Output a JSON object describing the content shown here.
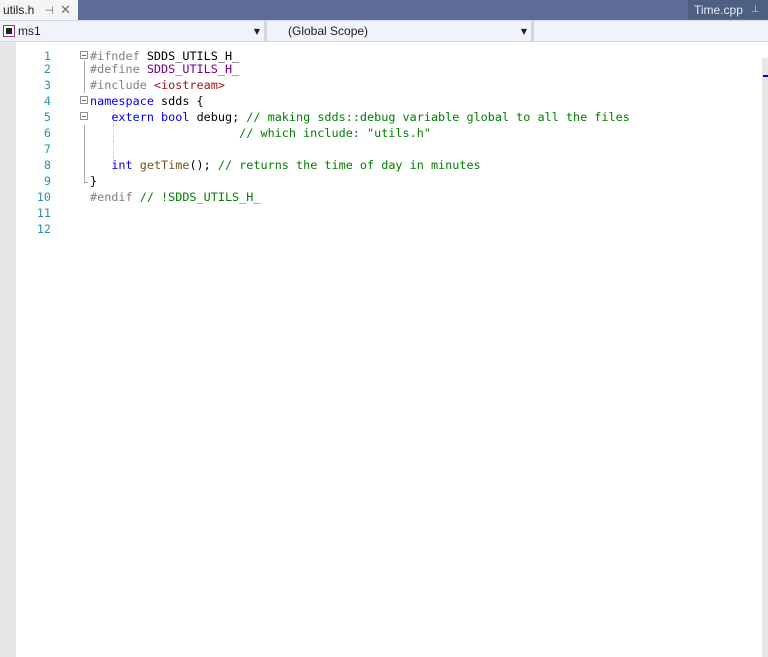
{
  "tabs": {
    "active": {
      "label": "utils.h",
      "pin_icon": "pin-icon",
      "close_icon": "close-icon"
    },
    "inactive": {
      "label": "Time.cpp",
      "pin_icon": "pin-icon"
    }
  },
  "navbar": {
    "project": "ms1",
    "scope": "(Global Scope)",
    "member": ""
  },
  "editor": {
    "lines": [
      {
        "n": "1",
        "tokens": [
          [
            "pp",
            "#ifndef "
          ],
          [
            "id",
            "SDDS_UTILS_H_"
          ]
        ]
      },
      {
        "n": "2",
        "tokens": [
          [
            "pp",
            "#define "
          ],
          [
            "macro",
            "SDDS_UTILS_H_"
          ]
        ]
      },
      {
        "n": "3",
        "tokens": [
          [
            "pp",
            "#include "
          ],
          [
            "str",
            "<iostream>"
          ]
        ]
      },
      {
        "n": "4",
        "tokens": [
          [
            "kw",
            "namespace"
          ],
          [
            "id",
            " sdds {"
          ]
        ]
      },
      {
        "n": "5",
        "tokens": [
          [
            "id",
            "   "
          ],
          [
            "kw",
            "extern"
          ],
          [
            "id",
            " "
          ],
          [
            "kw",
            "bool"
          ],
          [
            "id",
            " debug; "
          ],
          [
            "cm",
            "// making sdds::debug variable global to all the files"
          ]
        ]
      },
      {
        "n": "6",
        "tokens": [
          [
            "id",
            "                     "
          ],
          [
            "cm",
            "// which include: \"utils.h\""
          ]
        ]
      },
      {
        "n": "7",
        "tokens": []
      },
      {
        "n": "8",
        "tokens": [
          [
            "id",
            "   "
          ],
          [
            "kw",
            "int"
          ],
          [
            "id",
            " "
          ],
          [
            "fn",
            "getTime"
          ],
          [
            "id",
            "(); "
          ],
          [
            "cm",
            "// returns the time of day in minutes"
          ]
        ]
      },
      {
        "n": "9",
        "tokens": [
          [
            "id",
            "}"
          ]
        ]
      },
      {
        "n": "10",
        "tokens": [
          [
            "pp",
            "#endif "
          ],
          [
            "cm",
            "// !SDDS_UTILS_H_"
          ]
        ]
      },
      {
        "n": "11",
        "tokens": []
      },
      {
        "n": "12",
        "tokens": []
      }
    ]
  }
}
